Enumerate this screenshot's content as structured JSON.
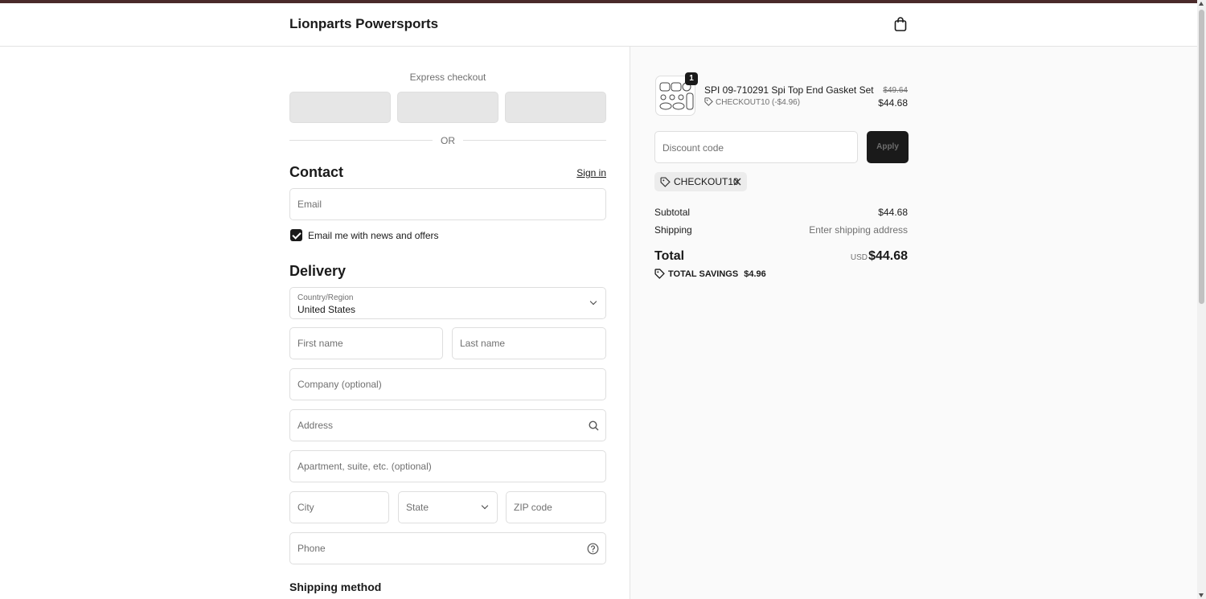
{
  "header": {
    "store_name": "Lionparts Powersports"
  },
  "express": {
    "label": "Express checkout",
    "or_text": "OR"
  },
  "contact": {
    "title": "Contact",
    "sign_in": "Sign in",
    "email_placeholder": "Email",
    "newsletter_label": "Email me with news and offers",
    "newsletter_checked": true
  },
  "delivery": {
    "title": "Delivery",
    "country_label": "Country/Region",
    "country_value": "United States",
    "first_name_placeholder": "First name",
    "last_name_placeholder": "Last name",
    "company_placeholder": "Company (optional)",
    "address_placeholder": "Address",
    "apartment_placeholder": "Apartment, suite, etc. (optional)",
    "city_placeholder": "City",
    "state_placeholder": "State",
    "zip_placeholder": "ZIP code",
    "phone_placeholder": "Phone"
  },
  "shipping_method": {
    "title": "Shipping method"
  },
  "order": {
    "item": {
      "quantity": "1",
      "title": "SPI 09-710291 Spi Top End Gasket Set",
      "discount": "CHECKOUT10 (-$4.96)",
      "original_price": "$49.64",
      "price": "$44.68"
    },
    "discount_placeholder": "Discount code",
    "apply_label": "Apply",
    "applied_code": "CHECKOUT10",
    "subtotal_label": "Subtotal",
    "subtotal_value": "$44.68",
    "shipping_label": "Shipping",
    "shipping_value": "Enter shipping address",
    "total_label": "Total",
    "currency": "USD",
    "total_value": "$44.68",
    "savings_label": "TOTAL SAVINGS",
    "savings_value": "$4.96"
  }
}
